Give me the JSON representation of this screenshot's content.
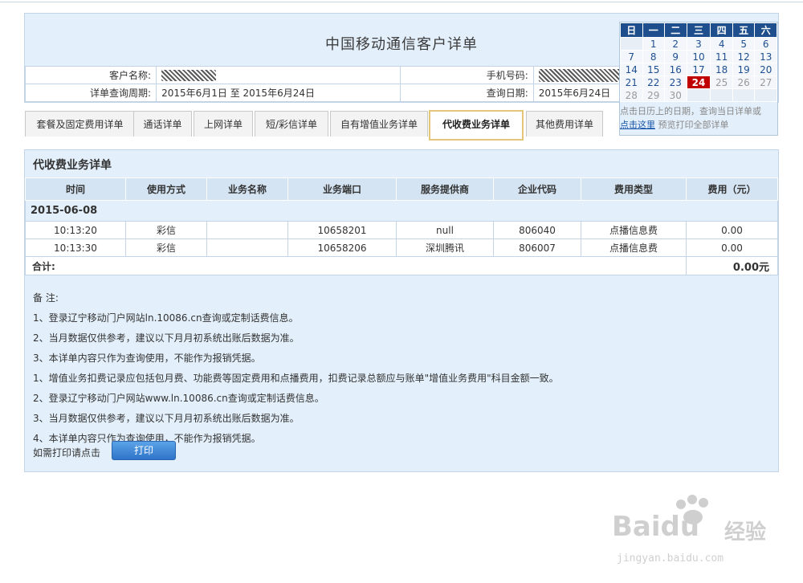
{
  "header": {
    "title": "中国移动通信客户详单",
    "customer_label": "客户名称:",
    "phone_label": "手机号码:",
    "period_label": "详单查询周期:",
    "period_value": "2015年6月1日 至 2015年6月24日",
    "query_date_label": "查询日期:",
    "query_date_value": "2015年6月24日"
  },
  "calendar": {
    "weekdays": [
      "日",
      "一",
      "二",
      "三",
      "四",
      "五",
      "六"
    ],
    "rows": [
      [
        "",
        "1",
        "2",
        "3",
        "4",
        "5",
        "6"
      ],
      [
        "7",
        "8",
        "9",
        "10",
        "11",
        "12",
        "13"
      ],
      [
        "14",
        "15",
        "16",
        "17",
        "18",
        "19",
        "20"
      ],
      [
        "21",
        "22",
        "23",
        "24",
        "25",
        "26",
        "27"
      ],
      [
        "28",
        "29",
        "30",
        "",
        "",
        "",
        ""
      ]
    ],
    "today": "24",
    "note_text": "点击日历上的日期，查询当日详单或",
    "link_text": "点击这里",
    "note_tail": "预览打印全部详单"
  },
  "tabs": [
    {
      "label": "套餐及固定费用详单",
      "active": false
    },
    {
      "label": "通话详单",
      "active": false
    },
    {
      "label": "上网详单",
      "active": false
    },
    {
      "label": "短/彩信详单",
      "active": false
    },
    {
      "label": "自有增值业务详单",
      "active": false
    },
    {
      "label": "代收费业务详单",
      "active": true
    },
    {
      "label": "其他费用详单",
      "active": false
    }
  ],
  "detail": {
    "section_title": "代收费业务详单",
    "columns": [
      "时间",
      "使用方式",
      "业务名称",
      "业务端口",
      "服务提供商",
      "企业代码",
      "费用类型",
      "费用（元）"
    ],
    "date_group": "2015-06-08",
    "rows": [
      [
        "10:13:20",
        "彩信",
        "",
        "10658201",
        "null",
        "806040",
        "点播信息费",
        "0.00"
      ],
      [
        "10:13:30",
        "彩信",
        "",
        "10658206",
        "深圳腾讯",
        "806007",
        "点播信息费",
        "0.00"
      ]
    ],
    "total_label": "合计:",
    "total_value": "0.00元"
  },
  "notes": {
    "heading": "备 注:",
    "lines": [
      "1、登录辽宁移动门户网站ln.10086.cn查询或定制话费信息。",
      "2、当月数据仅供参考，建议以下月月初系统出账后数据为准。",
      "3、本详单内容只作为查询使用，不能作为报销凭据。",
      "1、增值业务扣费记录应包括包月费、功能费等固定费用和点播费用，扣费记录总额应与账单\"增值业务费用\"科目金额一致。",
      "2、登录辽宁移动门户网站www.ln.10086.cn查询或定制话费信息。",
      "3、当月数据仅供参考，建议以下月月初系统出账后数据为准。",
      "4、本详单内容只作为查询使用，不能作为报销凭据。"
    ],
    "print_prompt": "如需打印请点击",
    "print_button": "打印"
  },
  "watermark": {
    "brand": "Baidu",
    "sub": "经验",
    "url": "jingyan.baidu.com"
  },
  "colors": {
    "panel_bg": "#e3effa",
    "header_navy": "#1e4f8c",
    "today_red": "#c00000",
    "button_blue": "#2f74c9"
  }
}
